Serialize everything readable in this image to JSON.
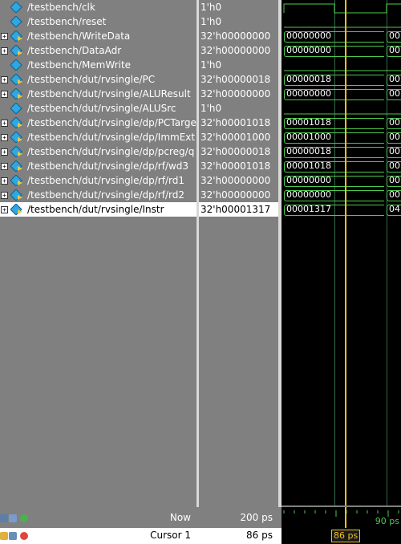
{
  "signals": [
    {
      "name": "/testbench/clk",
      "value": "1'h0",
      "kind": "bit",
      "expandable": false
    },
    {
      "name": "/testbench/reset",
      "value": "1'h0",
      "kind": "bit",
      "expandable": false
    },
    {
      "name": "/testbench/WriteData",
      "value": "32'h00000000",
      "kind": "bus",
      "expandable": true,
      "wave": "00000000",
      "next": "00"
    },
    {
      "name": "/testbench/DataAdr",
      "value": "32'h00000000",
      "kind": "bus",
      "expandable": true,
      "wave": "00000000",
      "next": "00"
    },
    {
      "name": "/testbench/MemWrite",
      "value": "1'h0",
      "kind": "bit",
      "expandable": false
    },
    {
      "name": "/testbench/dut/rvsingle/PC",
      "value": "32'h00000018",
      "kind": "bus",
      "expandable": true,
      "wave": "00000018",
      "next": "00"
    },
    {
      "name": "/testbench/dut/rvsingle/ALUResult",
      "value": "32'h00000000",
      "kind": "bus",
      "expandable": true,
      "wave": "00000000",
      "next": "00"
    },
    {
      "name": "/testbench/dut/rvsingle/ALUSrc",
      "value": "1'h0",
      "kind": "bit",
      "expandable": false
    },
    {
      "name": "/testbench/dut/rvsingle/dp/PCTarget",
      "value": "32'h00001018",
      "kind": "bus",
      "expandable": true,
      "wave": "00001018",
      "next": "00"
    },
    {
      "name": "/testbench/dut/rvsingle/dp/ImmExt",
      "value": "32'h00001000",
      "kind": "bus",
      "expandable": true,
      "wave": "00001000",
      "next": "00"
    },
    {
      "name": "/testbench/dut/rvsingle/dp/pcreg/q",
      "value": "32'h00000018",
      "kind": "bus",
      "expandable": true,
      "wave": "00000018",
      "next": "00"
    },
    {
      "name": "/testbench/dut/rvsingle/dp/rf/wd3",
      "value": "32'h00001018",
      "kind": "bus",
      "expandable": true,
      "wave": "00001018",
      "next": "00"
    },
    {
      "name": "/testbench/dut/rvsingle/dp/rf/rd1",
      "value": "32'h00000000",
      "kind": "bus",
      "expandable": true,
      "wave": "00000000",
      "next": "00"
    },
    {
      "name": "/testbench/dut/rvsingle/dp/rf/rd2",
      "value": "32'h00000000",
      "kind": "bus",
      "expandable": true,
      "wave": "00000000",
      "next": "00"
    },
    {
      "name": "/testbench/dut/rvsingle/Instr",
      "value": "32'h00001317",
      "kind": "bus",
      "expandable": true,
      "wave": "00001317",
      "next": "04",
      "selected": true
    }
  ],
  "footer": {
    "now_label": "Now",
    "now_value": "200 ps",
    "cursor_label": "Cursor 1",
    "cursor_value": "86 ps",
    "cursor_marker": "86 ps",
    "timeline_label": "90 ps"
  },
  "colors": {
    "wave_green": "#4ec94e",
    "cursor_yellow": "#f2c31a",
    "wave_bg": "#000000",
    "pane_bg": "#808080"
  }
}
